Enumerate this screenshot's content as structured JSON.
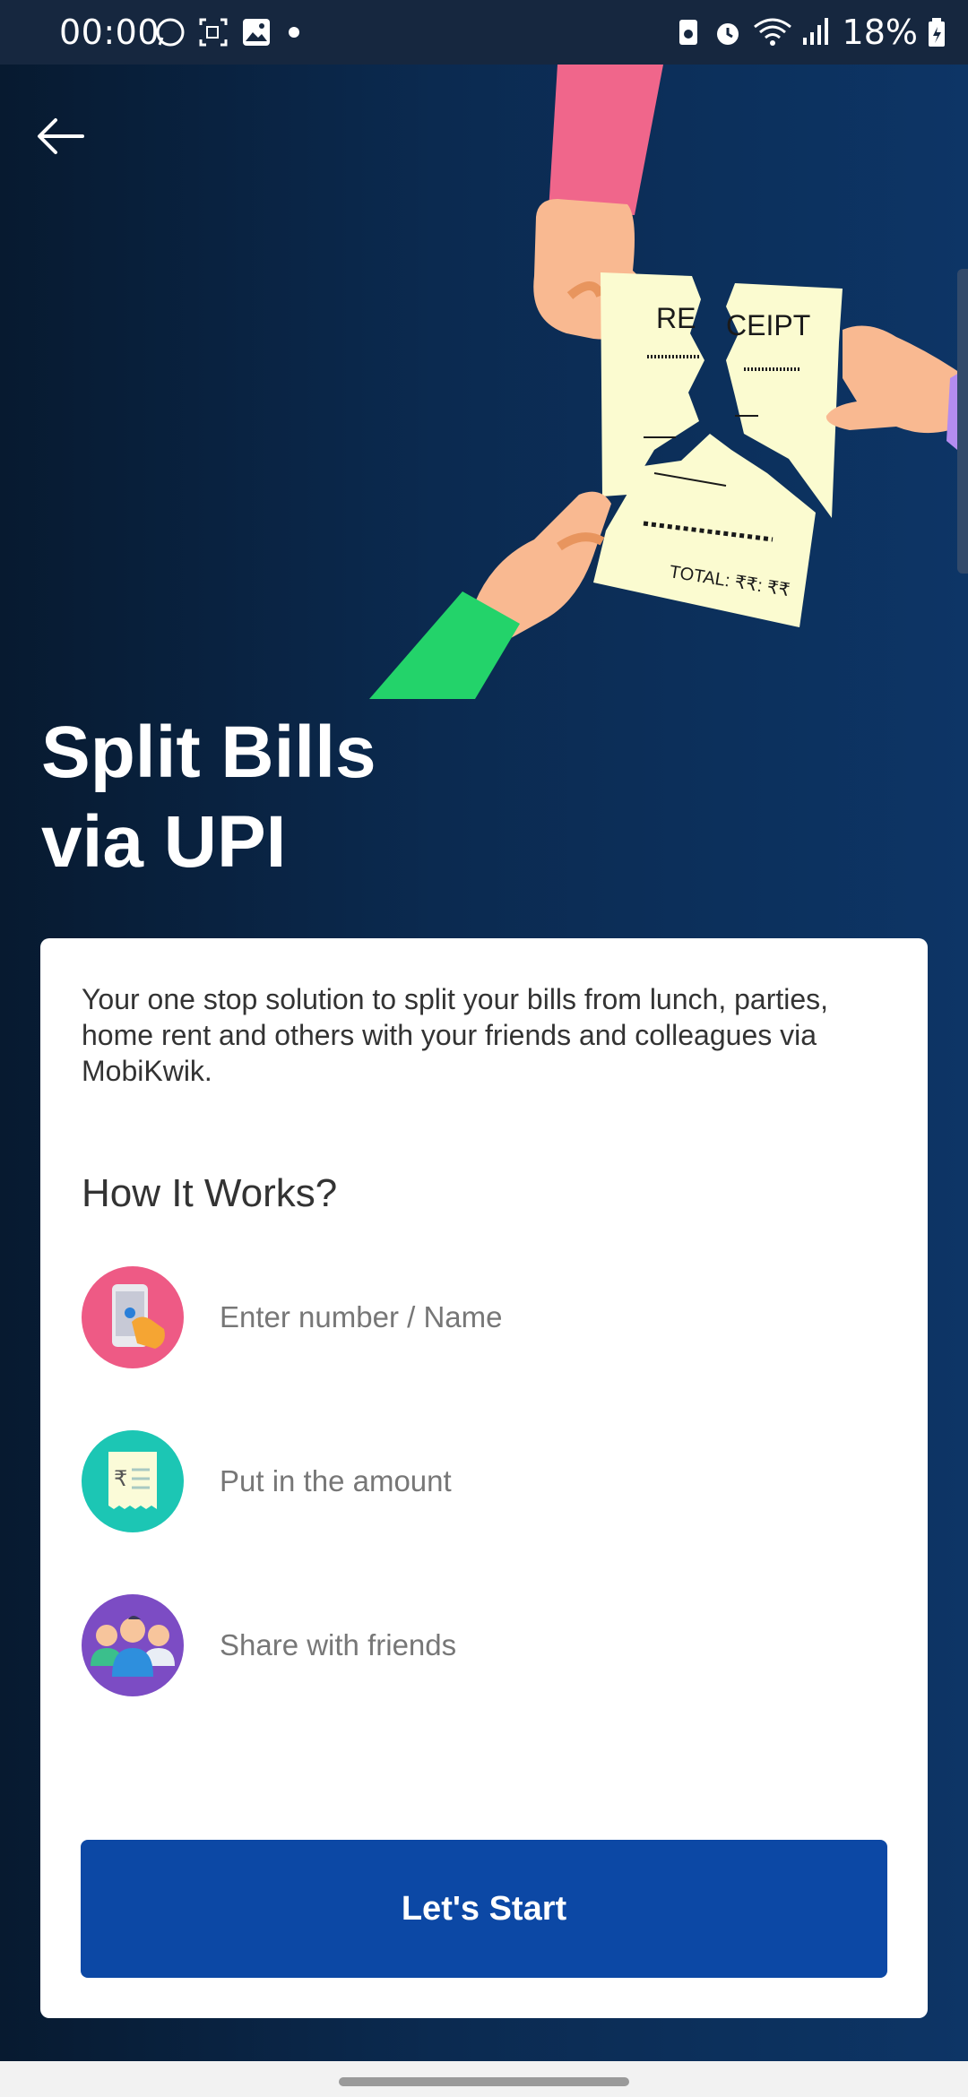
{
  "status_bar": {
    "time": "00:00",
    "battery": "18%",
    "left_icons": [
      "whatsapp-icon",
      "screen-record-icon",
      "gallery-icon",
      "dot-icon"
    ],
    "right_icons": [
      "battery-saver-icon",
      "alarm-icon",
      "wifi-icon",
      "signal-icon",
      "battery-icon"
    ]
  },
  "header": {
    "back_icon": "arrow-left-icon"
  },
  "illustration": {
    "receipt_text": "RECEIPT",
    "receipt_left": "RE",
    "receipt_right": "CEIPT",
    "total_text": "TOTAL: ₹₹: ₹₹"
  },
  "hero": {
    "title_line1": "Split Bills",
    "title_line2": "via UPI"
  },
  "card": {
    "description": "Your one stop solution to split your bills from lunch, parties, home rent and others with your friends and colleagues via MobiKwik.",
    "how_title": "How It Works?",
    "steps": [
      {
        "label": "Enter number / Name",
        "icon": "phone-tap-icon",
        "color": "#ee5a85"
      },
      {
        "label": "Put in the amount",
        "icon": "receipt-icon",
        "color": "#1cc6b4"
      },
      {
        "label": "Share with friends",
        "icon": "group-icon",
        "color": "#7c4cc4"
      }
    ],
    "cta_label": "Let's Start"
  },
  "colors": {
    "primary": "#0c48a5",
    "background": "#0b2446",
    "card": "#ffffff"
  }
}
